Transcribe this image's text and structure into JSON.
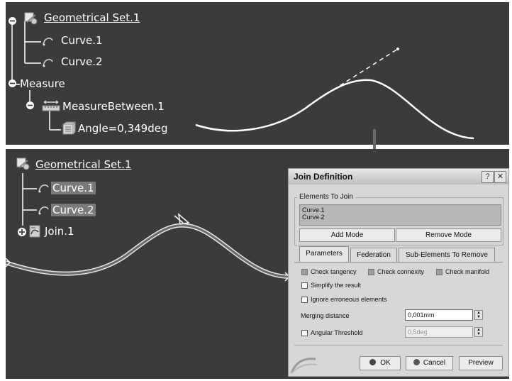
{
  "top_tree": {
    "geometrical_set": "Geometrical Set.1",
    "curve1": "Curve.1",
    "curve2": "Curve.2",
    "measure": "Measure",
    "measure_between": "MeasureBetween.1",
    "angle": "Angle=0,349deg"
  },
  "bottom_tree": {
    "geometrical_set": "Geometrical Set.1",
    "curve1": "Curve.1",
    "curve2": "Curve.2",
    "join": "Join.1"
  },
  "dialog": {
    "title": "Join Definition",
    "help_label": "?",
    "close_label": "✕",
    "elements_group": "Elements To Join",
    "elements": [
      "Curve.1",
      "Curve.2"
    ],
    "add_mode": "Add Mode",
    "remove_mode": "Remove Mode",
    "tabs": [
      "Parameters",
      "Federation",
      "Sub-Elements To Remove"
    ],
    "check_tangency": "Check tangency",
    "check_connexity": "Check connexity",
    "check_manifold": "Check manifold",
    "simplify": "Simplify the result",
    "ignore": "Ignore erroneous elements",
    "merging_label": "Merging distance",
    "merging_value": "0,001mm",
    "angular_label": "Angular Threshold",
    "angular_value": "0,5deg",
    "ok": "OK",
    "cancel": "Cancel",
    "preview": "Preview"
  },
  "colors": {
    "panel_bg": "#3b3b3b",
    "curve": "#ffffff",
    "dialog_bg": "#d7d7d7"
  }
}
